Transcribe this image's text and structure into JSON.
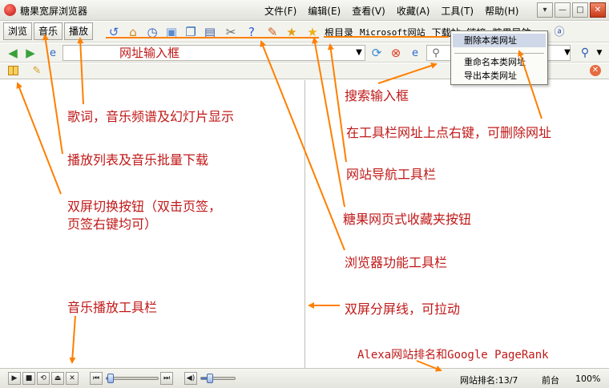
{
  "window": {
    "title": "糖果宽屏浏览器",
    "menu": [
      "文件(F)",
      "编辑(E)",
      "查看(V)",
      "收藏(A)",
      "工具(T)",
      "帮助(H)"
    ],
    "controls": [
      "▾",
      "—",
      "□",
      "✕"
    ]
  },
  "tabs": [
    "浏览",
    "音乐",
    "播放"
  ],
  "bookmarks": [
    "根目录",
    "Microsoft网站",
    "下载站",
    "链接",
    "糖果导航"
  ],
  "address": {
    "value": "网址输入框"
  },
  "context_menu": {
    "items": [
      "删除本类网址",
      "重命名本类网址",
      "导出本类网址"
    ]
  },
  "status": {
    "rank": "网站排名:13/7",
    "zone": "前台",
    "zoom": "100%"
  },
  "player": {
    "progress": 0.02,
    "volume": 0.2
  },
  "annotations": {
    "search_box": "搜索输入框",
    "lyrics": "歌词，音乐频谱及幻灯片显示",
    "right_click_delete": "在工具栏网址上点右键，可删除网址",
    "playlist": "播放列表及音乐批量下载",
    "nav_toolbar": "网站导航工具栏",
    "dual_toggle_1": "双屏切换按钮（双击页签，",
    "dual_toggle_2": "页签右键均可）",
    "favorites_button": "糖果网页式收藏夹按钮",
    "browser_toolbar": "浏览器功能工具栏",
    "music_toolbar": "音乐播放工具栏",
    "split_line": "双屏分屏线，可拉动",
    "alexa": "Alexa网站排名和Google PageRank"
  },
  "colors": {
    "annotation": "#c01818",
    "arrow": "#ff7f00"
  }
}
